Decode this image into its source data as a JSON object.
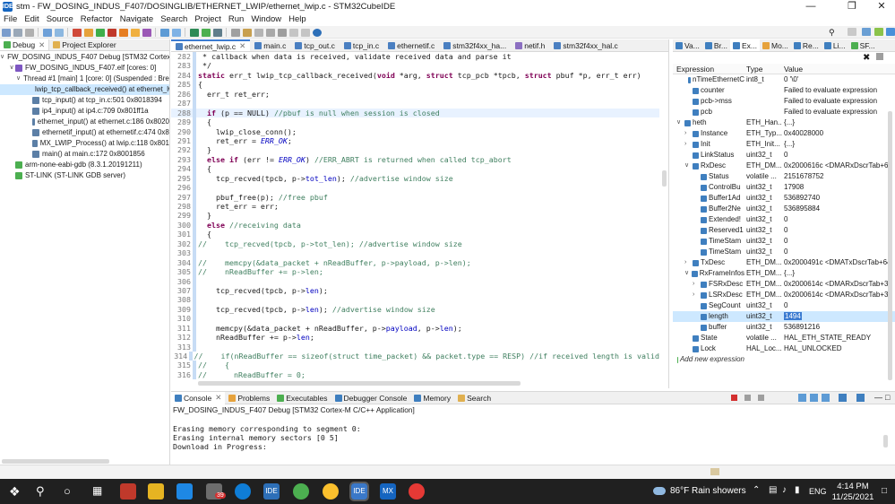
{
  "window": {
    "title": "stm - FW_DOSING_INDUS_F407/DOSINGLIB/ETHERNET_LWIP/ethernet_lwip.c - STM32CubeIDE"
  },
  "menu": [
    "File",
    "Edit",
    "Source",
    "Refactor",
    "Navigate",
    "Search",
    "Project",
    "Run",
    "Window",
    "Help"
  ],
  "left_panel": {
    "tabs": [
      "Debug",
      "Project Explorer"
    ],
    "tree": [
      {
        "label": "FW_DOSING_INDUS_F407 Debug [STM32 Cortex-M C/C++ Application]"
      },
      {
        "label": "FW_DOSING_INDUS_F407.elf [cores: 0]"
      },
      {
        "label": "Thread #1 [main] 1 [core: 0] (Suspended : Breakpoint)"
      },
      {
        "label": "lwip_tcp_callback_received() at ethernet_lwip.c:288 0x8001440"
      },
      {
        "label": "tcp_input() at tcp_in.c:501 0x8018394"
      },
      {
        "label": "ip4_input() at ip4.c:709 0x801ff1a"
      },
      {
        "label": "ethernet_input() at ethernet.c:186 0x8020"
      },
      {
        "label": "ethernetif_input() at ethernetif.c:474 0x8"
      },
      {
        "label": "MX_LWIP_Process() at lwip.c:118 0x801"
      },
      {
        "label": "main() at main.c:172 0x8001856"
      },
      {
        "label": "arm-none-eabi-gdb (8.3.1.20191211)"
      },
      {
        "label": "ST-LINK (ST-LINK GDB server)"
      }
    ]
  },
  "editor": {
    "tabs": [
      "ethernet_lwip.c",
      "main.c",
      "tcp_out.c",
      "tcp_in.c",
      "ethernetif.c",
      "stm32f4xx_ha...",
      "netif.h",
      "stm32f4xx_hal.c"
    ],
    "lines": [
      {
        "n": "282",
        "t": " * callback when data is received, validate received data and parse it"
      },
      {
        "n": "283",
        "t": " */"
      },
      {
        "n": "284",
        "t": "static err_t lwip_tcp_callback_received(void *arg, struct tcp_pcb *tpcb, struct pbuf *p, err_t err)"
      },
      {
        "n": "285",
        "t": "{"
      },
      {
        "n": "286",
        "t": "  err_t ret_err;"
      },
      {
        "n": "287",
        "t": ""
      },
      {
        "n": "288",
        "t": "  if (p == NULL) //pbuf is null when session is closed"
      },
      {
        "n": "289",
        "t": "  {"
      },
      {
        "n": "290",
        "t": "    lwip_close_conn();"
      },
      {
        "n": "291",
        "t": "    ret_err = ERR_OK;"
      },
      {
        "n": "292",
        "t": "  }"
      },
      {
        "n": "293",
        "t": "  else if (err != ERR_OK) //ERR_ABRT is returned when called tcp_abort"
      },
      {
        "n": "294",
        "t": "  {"
      },
      {
        "n": "295",
        "t": "    tcp_recved(tpcb, p->tot_len); //advertise window size"
      },
      {
        "n": "296",
        "t": ""
      },
      {
        "n": "297",
        "t": "    pbuf_free(p); //free pbuf"
      },
      {
        "n": "298",
        "t": "    ret_err = err;"
      },
      {
        "n": "299",
        "t": "  }"
      },
      {
        "n": "300",
        "t": "  else //receiving data"
      },
      {
        "n": "301",
        "t": "  {"
      },
      {
        "n": "302",
        "t": "//    tcp_recved(tpcb, p->tot_len); //advertise window size"
      },
      {
        "n": "303",
        "t": ""
      },
      {
        "n": "304",
        "t": "//    memcpy(&data_packet + nReadBuffer, p->payload, p->len);"
      },
      {
        "n": "305",
        "t": "//    nReadBuffer += p->len;"
      },
      {
        "n": "306",
        "t": ""
      },
      {
        "n": "307",
        "t": "    tcp_recved(tpcb, p->len);"
      },
      {
        "n": "308",
        "t": ""
      },
      {
        "n": "309",
        "t": "    tcp_recved(tpcb, p->len); //advertise window size"
      },
      {
        "n": "310",
        "t": ""
      },
      {
        "n": "311",
        "t": "    memcpy(&data_packet + nReadBuffer, p->payload, p->len);"
      },
      {
        "n": "312",
        "t": "    nReadBuffer += p->len;"
      },
      {
        "n": "313",
        "t": ""
      },
      {
        "n": "314",
        "t": "//    if(nReadBuffer == sizeof(struct time_packet) && packet.type == RESP) //if received length is valid"
      },
      {
        "n": "315",
        "t": "//    {"
      },
      {
        "n": "316",
        "t": "//      nReadBuffer = 0;"
      }
    ]
  },
  "right_panel": {
    "tabs": [
      "Va...",
      "Br...",
      "Ex...",
      "Mo...",
      "Re...",
      "Li...",
      "SF..."
    ],
    "headers": [
      "Expression",
      "Type",
      "Value"
    ],
    "rows": [
      {
        "e": "nTimeEthernetC",
        "t": "int8_t",
        "v": "0 '\\0'"
      },
      {
        "e": "counter",
        "t": "",
        "v": "Failed to evaluate expression"
      },
      {
        "e": "pcb->mss",
        "t": "",
        "v": "Failed to evaluate expression"
      },
      {
        "e": "pcb",
        "t": "",
        "v": "Failed to evaluate expression"
      },
      {
        "e": "heth",
        "t": "ETH_Han...",
        "v": "{...}"
      },
      {
        "e": "Instance",
        "t": "ETH_Typ...",
        "v": "0x40028000"
      },
      {
        "e": "Init",
        "t": "ETH_Init...",
        "v": "{...}"
      },
      {
        "e": "LinkStatus",
        "t": "uint32_t",
        "v": "0"
      },
      {
        "e": "RxDesc",
        "t": "ETH_DM...",
        "v": "0x2000616c <DMARxDscrTab+64>"
      },
      {
        "e": "Status",
        "t": "volatile ...",
        "v": "2151678752"
      },
      {
        "e": "ControlBu",
        "t": "uint32_t",
        "v": "17908"
      },
      {
        "e": "Buffer1Ad",
        "t": "uint32_t",
        "v": "536892740"
      },
      {
        "e": "Buffer2Ne",
        "t": "uint32_t",
        "v": "536895884"
      },
      {
        "e": "Extended!",
        "t": "uint32_t",
        "v": "0"
      },
      {
        "e": "Reserved1",
        "t": "uint32_t",
        "v": "0"
      },
      {
        "e": "TimeStam",
        "t": "uint32_t",
        "v": "0"
      },
      {
        "e": "TimeStam",
        "t": "uint32_t",
        "v": "0"
      },
      {
        "e": "TxDesc",
        "t": "ETH_DM...",
        "v": "0x2000491c <DMATxDscrTab+64>"
      },
      {
        "e": "RxFrameInfos",
        "t": "ETH_DM...",
        "v": "{...}"
      },
      {
        "e": "FSRxDesc",
        "t": "ETH_DM...",
        "v": "0x2000614c <DMARxDscrTab+32>"
      },
      {
        "e": "LSRxDesc",
        "t": "ETH_DM...",
        "v": "0x2000614c <DMARxDscrTab+32>"
      },
      {
        "e": "SegCount",
        "t": "uint32_t",
        "v": "0"
      },
      {
        "e": "length",
        "t": "uint32_t",
        "v": "1494"
      },
      {
        "e": "buffer",
        "t": "uint32_t",
        "v": "536891216"
      },
      {
        "e": "State",
        "t": "volatile ...",
        "v": "HAL_ETH_STATE_READY"
      },
      {
        "e": "Lock",
        "t": "HAL_Loc...",
        "v": "HAL_UNLOCKED"
      },
      {
        "e": "Add new expression",
        "t": "",
        "v": ""
      }
    ]
  },
  "console": {
    "tabs": [
      "Console",
      "Problems",
      "Executables",
      "Debugger Console",
      "Memory",
      "Search"
    ],
    "title": "FW_DOSING_INDUS_F407 Debug [STM32 Cortex-M C/C++ Application]",
    "lines": [
      "",
      "Erasing memory corresponding to segment 0:",
      "Erasing internal memory sectors [0 5]",
      "Download in Progress:"
    ]
  },
  "taskbar": {
    "badge": "39",
    "weather": "86°F  Rain showers",
    "lang": "ENG",
    "time": "4:14 PM",
    "date": "11/25/2021"
  }
}
